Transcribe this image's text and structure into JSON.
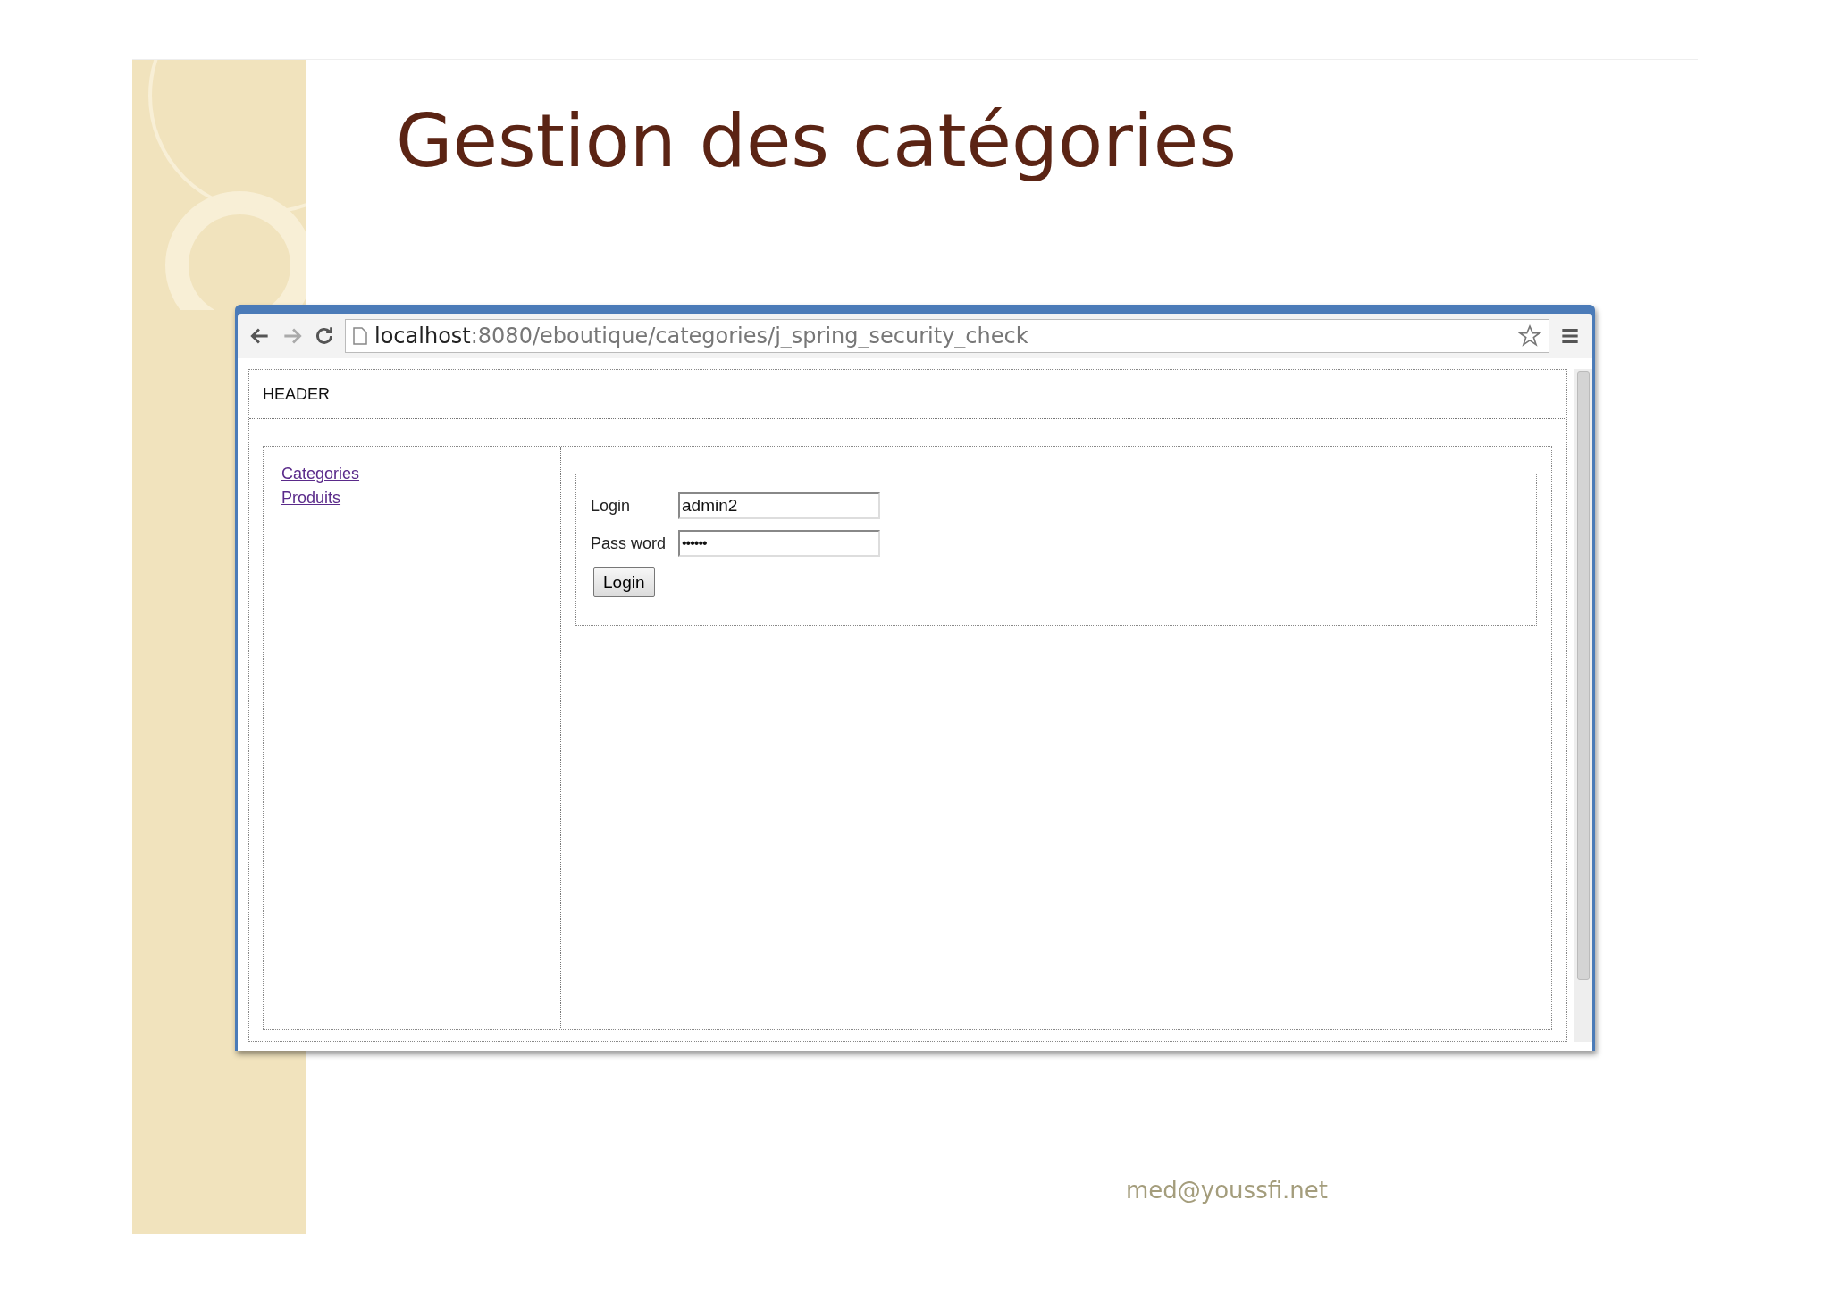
{
  "slide": {
    "title": "Gestion des catégories",
    "footer": "med@youssfi.net"
  },
  "browser": {
    "url_host": "localhost",
    "url_path": ":8080/eboutique/categories/j_spring_security_check",
    "header": "HEADER",
    "nav_links": [
      {
        "label": "Categories"
      },
      {
        "label": "Produits"
      }
    ],
    "form": {
      "fields": [
        {
          "label": "Login",
          "value": "admin2",
          "kind": "text"
        },
        {
          "label": "Pass word",
          "value": "••••••",
          "kind": "password"
        }
      ],
      "submit": "Login"
    }
  }
}
